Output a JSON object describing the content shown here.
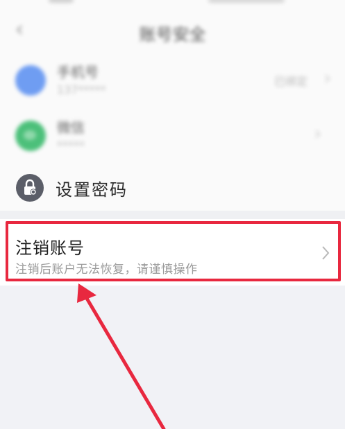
{
  "header": {
    "title": "账号安全",
    "back_glyph": "‹"
  },
  "accounts": [
    {
      "label": "手机号",
      "sub": "137*****",
      "value": "已绑定",
      "icon": "phone-avatar-icon",
      "color": "#6f9df2"
    },
    {
      "label": "微信",
      "sub": "*****",
      "value": "",
      "icon": "wechat-icon",
      "color": "#4cc07a"
    }
  ],
  "password": {
    "label": "设置密码",
    "icon": "lock-icon"
  },
  "delete_account": {
    "title": "注销账号",
    "subtitle": "注销后账户无法恢复，请谨慎操作",
    "icon": "chevron-right-icon"
  },
  "annotation": {
    "highlight_color": "#e8283f",
    "arrow_color": "#e8283f"
  }
}
